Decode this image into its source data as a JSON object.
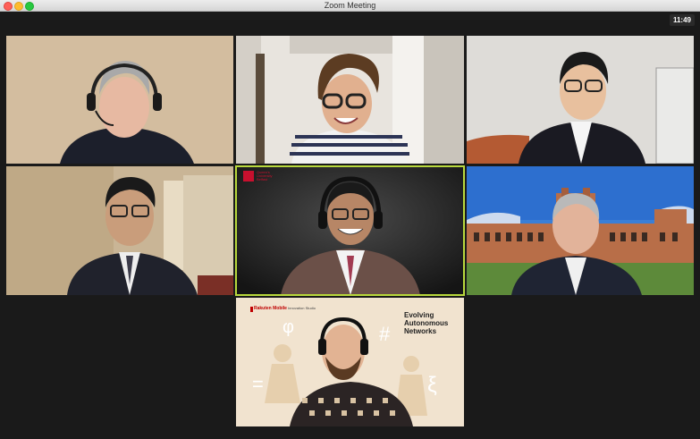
{
  "window": {
    "title": "Zoom Meeting",
    "clock": "11:49",
    "colors": {
      "active_speaker_border": "#b8d83c",
      "background": "#1a1a1a"
    }
  },
  "gallery": {
    "tiles": [
      {
        "id": "tile-1",
        "description": "older man with headset in dark room"
      },
      {
        "id": "tile-2",
        "description": "woman with glasses in striped shirt"
      },
      {
        "id": "tile-3",
        "description": "man in suit with glasses, white room"
      },
      {
        "id": "tile-4",
        "description": "man with glasses in suit, beige room"
      },
      {
        "id": "tile-5",
        "description": "man with headset, active speaker",
        "active": true
      },
      {
        "id": "tile-6",
        "description": "man in front of university building"
      },
      {
        "id": "tile-7",
        "description": "man with headset, branded background"
      }
    ],
    "tile5_logo": {
      "line1": "Queen's",
      "line2": "University",
      "line3": "Belfast"
    },
    "tile7_brand": {
      "company": "Rakuten Mobile",
      "subtitle": "Innovation Studio",
      "headline_lines": [
        "Evolving",
        "Autonomous",
        "Networks"
      ],
      "symbols": [
        "φ",
        "#",
        "=",
        "ξ"
      ]
    }
  }
}
